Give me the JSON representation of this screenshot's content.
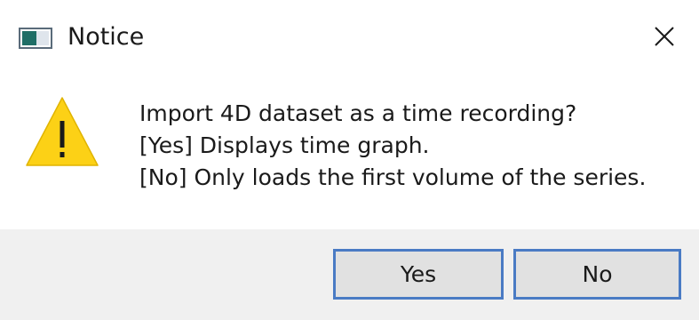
{
  "window": {
    "title": "Notice",
    "app_icon": "app-window-icon",
    "close_icon": "close-icon"
  },
  "message": {
    "icon": "warning-icon",
    "lines": [
      "Import 4D dataset as a time recording?",
      "[Yes] Displays time graph.",
      "[No] Only loads the first volume of the series."
    ]
  },
  "buttons": {
    "yes_label": "Yes",
    "no_label": "No"
  },
  "colors": {
    "footer_bg": "#f0f0f0",
    "button_bg": "#e1e1e1",
    "button_border": "#4a7bc4",
    "warning_fill": "#fcd116"
  }
}
